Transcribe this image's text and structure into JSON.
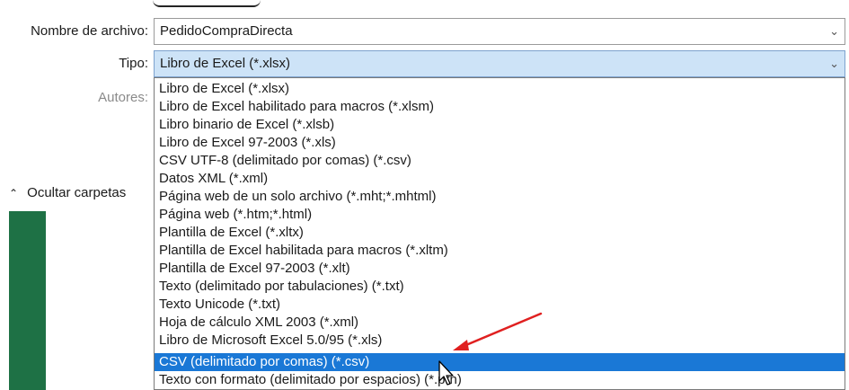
{
  "form": {
    "name_label": "Nombre de archivo:",
    "name_value": "PedidoCompraDirecta",
    "type_label": "Tipo:",
    "type_value": "Libro de Excel (*.xlsx)",
    "authors_label": "Autores:"
  },
  "sidebar": {
    "hide_folders_label": "Ocultar carpetas"
  },
  "dropdown": {
    "options": [
      "Libro de Excel (*.xlsx)",
      "Libro de Excel habilitado para macros (*.xlsm)",
      "Libro binario de Excel (*.xlsb)",
      "Libro de Excel 97-2003 (*.xls)",
      "CSV UTF-8 (delimitado por comas) (*.csv)",
      "Datos XML (*.xml)",
      "Página web de un solo archivo (*.mht;*.mhtml)",
      "Página web (*.htm;*.html)",
      "Plantilla de Excel (*.xltx)",
      "Plantilla de Excel habilitada para macros (*.xltm)",
      "Plantilla de Excel 97-2003 (*.xlt)",
      "Texto (delimitado por tabulaciones) (*.txt)",
      "Texto Unicode (*.txt)",
      "Hoja de cálculo XML 2003 (*.xml)",
      "Libro de Microsoft Excel 5.0/95 (*.xls)",
      "CSV (delimitado por comas) (*.csv)",
      "Texto con formato (delimitado por espacios) (*.prn)"
    ],
    "selected_index": 15
  },
  "colors": {
    "selected_bg": "#1a78d6",
    "field_highlight": "#cde3f7",
    "excel_green": "#1e7145",
    "annotation_arrow": "#e02020"
  },
  "icons": [
    "chevron-down-icon",
    "chevron-up-icon",
    "red-arrow-annotation",
    "mouse-cursor-icon"
  ]
}
